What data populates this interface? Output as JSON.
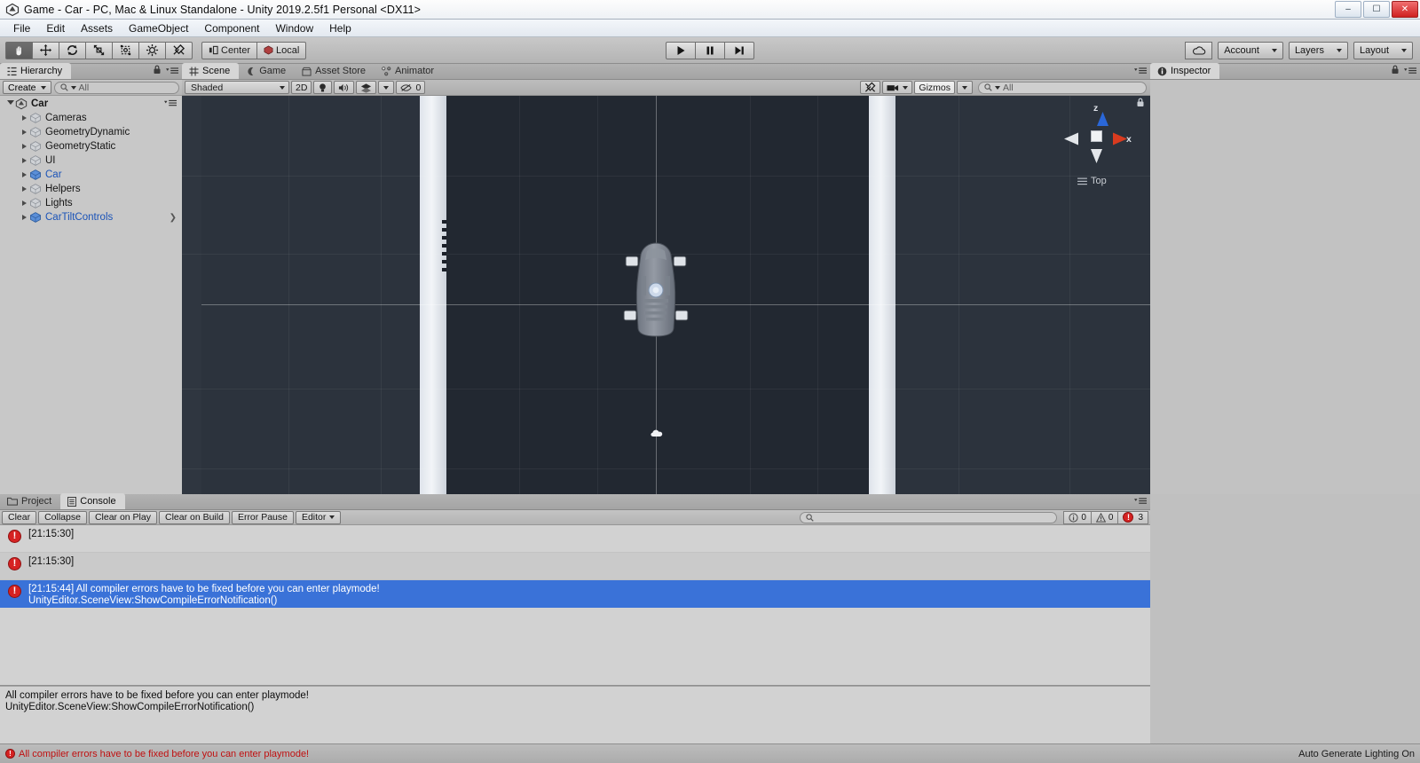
{
  "window": {
    "title": "Game - Car - PC, Mac & Linux Standalone - Unity 2019.2.5f1 Personal <DX11>",
    "app_icon": "unity-icon",
    "minimize": "–",
    "maximize": "☐",
    "close": "✕"
  },
  "menubar": {
    "items": [
      "File",
      "Edit",
      "Assets",
      "GameObject",
      "Component",
      "Window",
      "Help"
    ]
  },
  "toolbar": {
    "transform_tools": [
      {
        "name": "hand-tool",
        "glyph": "✋",
        "active": true
      },
      {
        "name": "move-tool",
        "glyph": "✥",
        "active": false
      },
      {
        "name": "rotate-tool",
        "glyph": "↻",
        "active": false
      },
      {
        "name": "scale-tool",
        "glyph": "⤡",
        "active": false
      },
      {
        "name": "rect-tool",
        "glyph": "▣",
        "active": false
      },
      {
        "name": "transform-tool",
        "glyph": "⊕",
        "active": false
      },
      {
        "name": "custom-tool",
        "glyph": "⚒",
        "active": false
      }
    ],
    "pivot_mode": "Center",
    "pivot_rotation": "Local",
    "play": "▶",
    "pause": "❙❙",
    "step": "▶❙",
    "cloud_label": "cloud-icon",
    "account": "Account",
    "layers": "Layers",
    "layout": "Layout"
  },
  "hierarchy": {
    "tab": "Hierarchy",
    "create_button": "Create",
    "search_placeholder": "All",
    "scene_name": "Car",
    "items": [
      {
        "label": "Cameras",
        "prefab": false,
        "chevron": false
      },
      {
        "label": "GeometryDynamic",
        "prefab": false,
        "chevron": false
      },
      {
        "label": "GeometryStatic",
        "prefab": false,
        "chevron": false
      },
      {
        "label": "UI",
        "prefab": false,
        "chevron": false
      },
      {
        "label": "Car",
        "prefab": true,
        "chevron": false
      },
      {
        "label": "Helpers",
        "prefab": false,
        "chevron": false
      },
      {
        "label": "Lights",
        "prefab": false,
        "chevron": false
      },
      {
        "label": "CarTiltControls",
        "prefab": true,
        "chevron": true
      }
    ]
  },
  "scene": {
    "tabs": [
      {
        "label": "Scene",
        "icon": "grid-icon",
        "active": true
      },
      {
        "label": "Game",
        "icon": "gamepad-icon",
        "active": false
      },
      {
        "label": "Asset Store",
        "icon": "store-icon",
        "active": false
      },
      {
        "label": "Animator",
        "icon": "animator-icon",
        "active": false
      }
    ],
    "draw_mode": "Shaded",
    "mode_2d": "2D",
    "lighting_icon": "lightbulb-icon",
    "audio_icon": "speaker-icon",
    "effects_icon": "effects-icon",
    "gizmo_visibility_icon": "eye-off-icon",
    "gizmo_count": "0",
    "tools_icon": "tools-icon",
    "camera_icon": "camera-icon",
    "gizmos_button": "Gizmos",
    "search_placeholder": "All",
    "view_gizmo": {
      "axis_z": "z",
      "axis_x": "x",
      "view_label": "Top",
      "menu_icon": "hamburger-icon",
      "color_z": "#2a67d8",
      "color_x": "#d93b1f",
      "color_neutral": "#e8eaee"
    }
  },
  "inspector": {
    "tab": "Inspector",
    "icon": "info-icon",
    "lock_icon": "lock-icon",
    "menu_icon": "menu-icon"
  },
  "console": {
    "tabs": [
      {
        "label": "Project",
        "icon": "folder-icon",
        "active": false
      },
      {
        "label": "Console",
        "icon": "console-icon",
        "active": true
      }
    ],
    "buttons": [
      "Clear",
      "Collapse",
      "Clear on Play",
      "Clear on Build",
      "Error Pause"
    ],
    "editor_dropdown": "Editor",
    "search_placeholder": "",
    "counts": {
      "info": "0",
      "warning": "0",
      "error": "3"
    },
    "entries": [
      {
        "icon": "error-icon",
        "line1": "[21:15:30]",
        "line2": "",
        "selected": false
      },
      {
        "icon": "error-icon",
        "line1": "[21:15:30]",
        "line2": "",
        "selected": false
      },
      {
        "icon": "error-icon",
        "line1": "[21:15:44] All compiler errors have to be fixed before you can enter playmode!",
        "line2": "UnityEditor.SceneView:ShowCompileErrorNotification()",
        "selected": true
      }
    ],
    "detail": {
      "line1": "All compiler errors have to be fixed before you can enter playmode!",
      "line2": "UnityEditor.SceneView:ShowCompileErrorNotification()"
    }
  },
  "statusbar": {
    "error_icon": "error-icon",
    "message": "All compiler errors have to be fixed before you can enter playmode!",
    "right": "Auto Generate Lighting On"
  },
  "colors": {
    "scene_bg": "#2b323b",
    "road_dark": "#232a33",
    "road_light": "#e8ecf1",
    "selection_blue": "#3a72d8",
    "error_red": "#d62222",
    "prefab_blue": "#1a53b8"
  }
}
